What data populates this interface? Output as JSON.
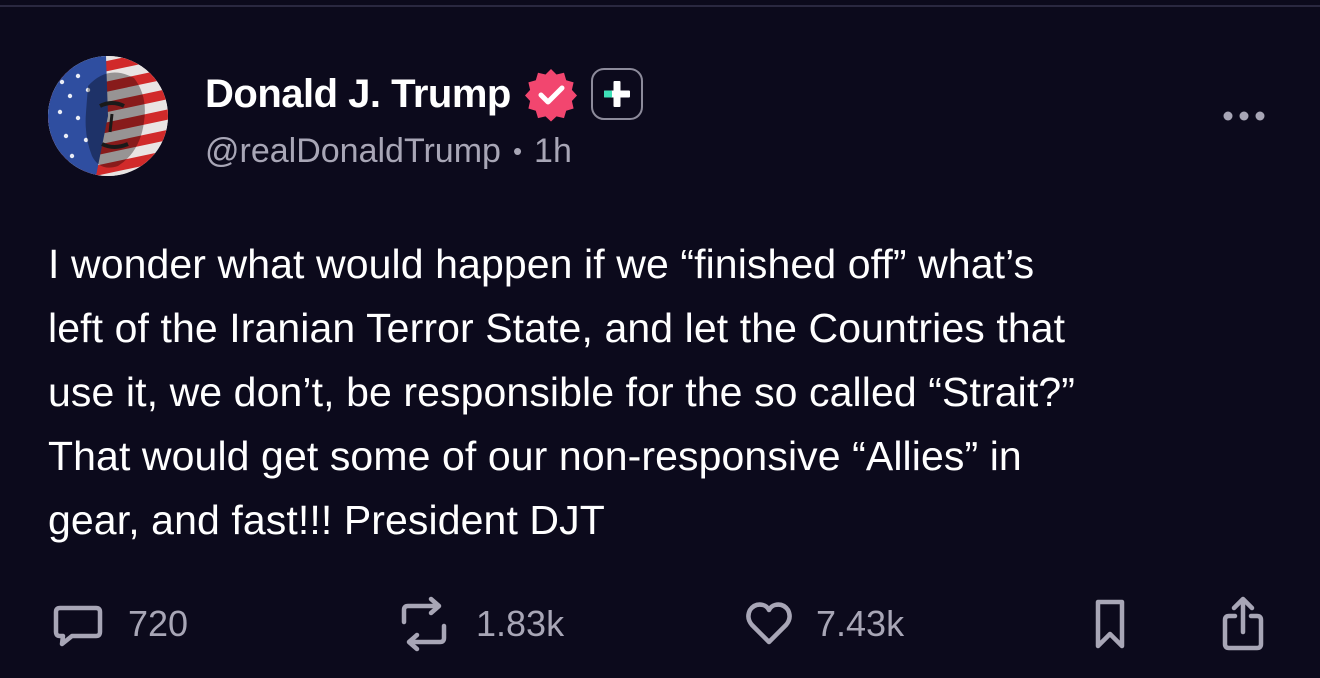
{
  "author": {
    "display_name": "Donald J. Trump",
    "handle": "@realDonaldTrump",
    "separator": "•",
    "time": "1h"
  },
  "post": {
    "lines": [
      "I wonder what would happen if we “finished off” what’s",
      "left of the Iranian Terror State, and let the Countries that",
      "use it, we don’t, be responsible for the so called “Strait?”",
      "That would get some of our non-responsive “Allies” in",
      "gear, and fast!!! President DJT"
    ]
  },
  "actions": {
    "replies": "720",
    "reposts": "1.83k",
    "likes": "7.43k"
  },
  "icons": {
    "verified": "verified-badge-icon",
    "plus": "plus-badge-icon",
    "more": "more-options-icon",
    "reply": "reply-icon",
    "repost": "repost-icon",
    "like": "heart-icon",
    "bookmark": "bookmark-icon",
    "share": "share-icon"
  },
  "colors": {
    "background": "#0c0a1c",
    "text": "#ffffff",
    "muted": "#a8a6b6",
    "verified": "#f2466f",
    "plus_accent": "#3ee0b8"
  }
}
